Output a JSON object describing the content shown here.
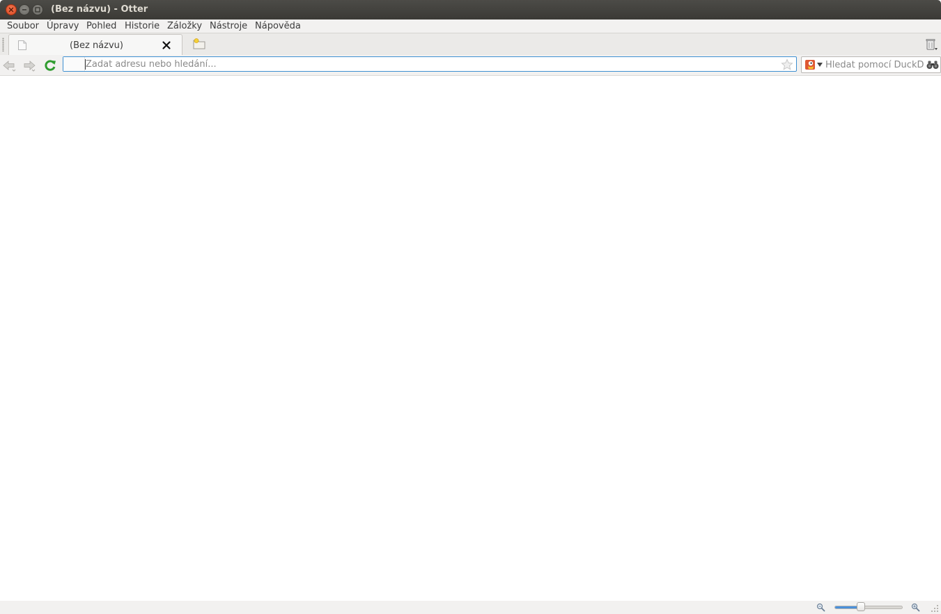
{
  "window": {
    "title": "(Bez názvu) - Otter"
  },
  "menu": {
    "items": [
      "Soubor",
      "Úpravy",
      "Pohled",
      "Historie",
      "Záložky",
      "Nástroje",
      "Nápověda"
    ]
  },
  "tabs": [
    {
      "title": "(Bez názvu)"
    }
  ],
  "address_bar": {
    "value": "",
    "placeholder": "Zadat adresu nebo hledání..."
  },
  "search": {
    "placeholder": "Hledat pomocí DuckD...",
    "engine": "DuckDuckGo"
  },
  "icons": {
    "back": "back-arrow-icon",
    "forward": "forward-arrow-icon",
    "reload": "reload-icon",
    "bookmark": "star-icon",
    "search": "binoculars-icon",
    "new_tab": "new-tab-icon",
    "closed_tabs": "trash-icon"
  },
  "zoom": {
    "level_fraction": 0.39
  },
  "colors": {
    "accent": "#3d8fd1",
    "titlebar": "#3b3a36",
    "close_button": "#e25a32"
  }
}
